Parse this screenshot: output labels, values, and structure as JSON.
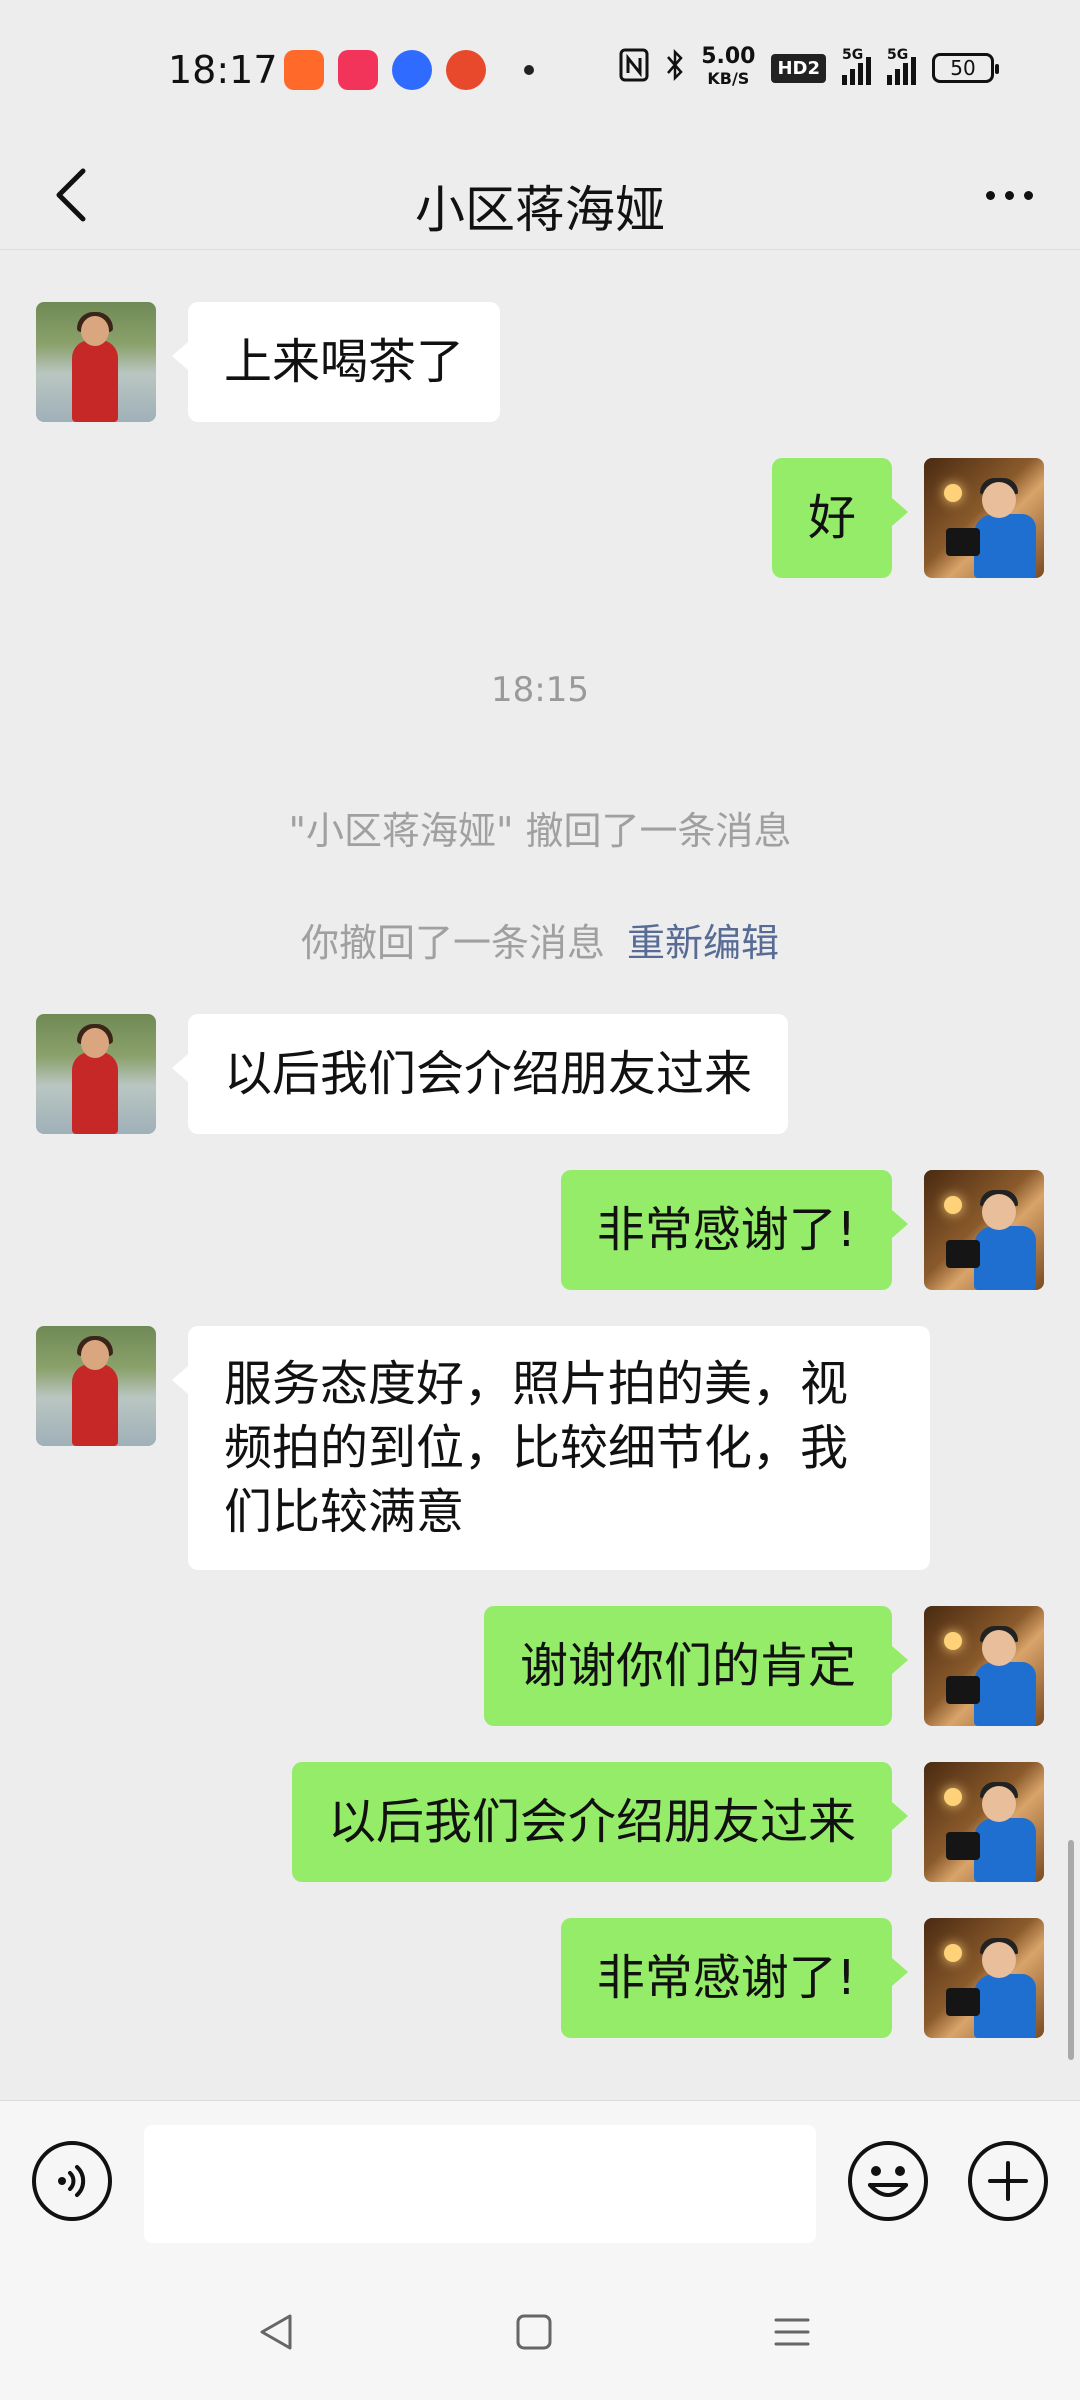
{
  "status_bar": {
    "time": "18:17",
    "net_speed_value": "5.00",
    "net_speed_unit": "KB/S",
    "hd_label": "HD2",
    "signal1_label": "5G",
    "signal2_label": "5G",
    "battery": "50"
  },
  "header": {
    "title": "小区蒋海娅"
  },
  "messages": {
    "m1": "上来喝茶了",
    "m2": "好",
    "time_divider": "18:15",
    "recall_other": "\"小区蒋海娅\" 撤回了一条消息",
    "recall_self": "你撤回了一条消息",
    "reedit_link": "重新编辑",
    "m3": "以后我们会介绍朋友过来",
    "m4": "非常感谢了!",
    "m5": "服务态度好，照片拍的美，视频拍的到位，比较细节化，我们比较满意",
    "m6": "谢谢你们的肯定",
    "m7": "以后我们会介绍朋友过来",
    "m8": "非常感谢了!"
  },
  "input": {
    "placeholder": ""
  },
  "colors": {
    "background": "#ededed",
    "outgoing_bubble": "#95ec69",
    "incoming_bubble": "#ffffff",
    "link": "#576b95"
  }
}
